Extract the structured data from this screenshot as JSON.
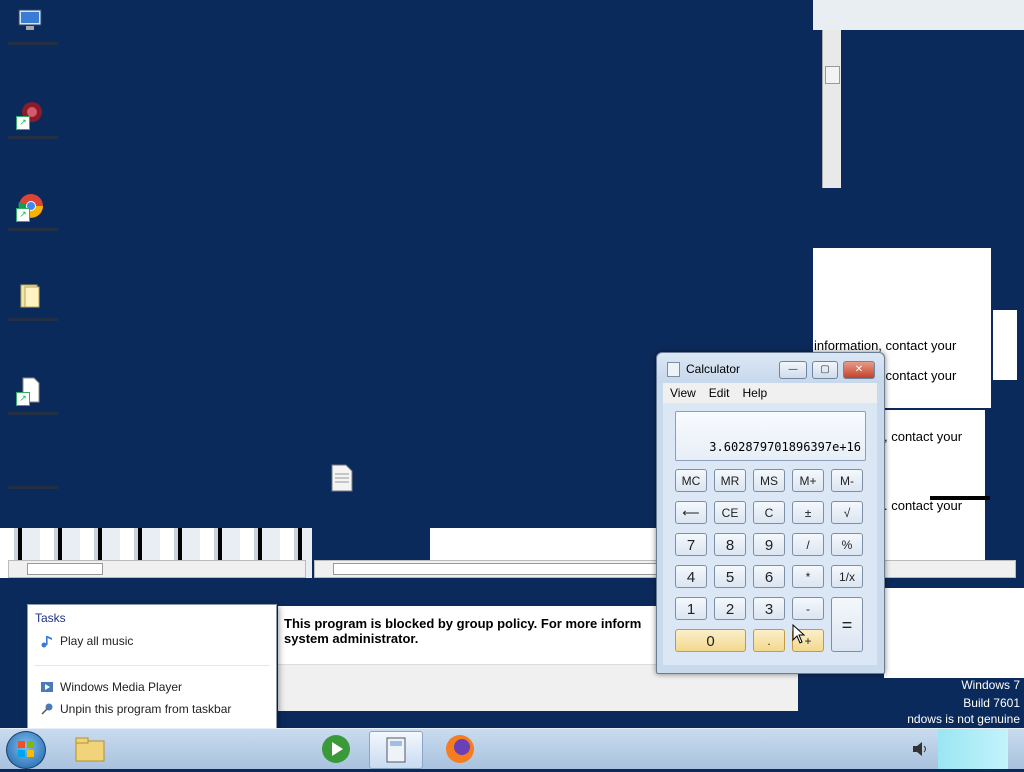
{
  "desktop": {
    "icons": [
      {
        "name": "computer-icon"
      },
      {
        "name": "network-tool-shortcut-icon"
      },
      {
        "name": "chrome-shortcut-icon"
      },
      {
        "name": "folder-icon"
      },
      {
        "name": "document-shortcut-icon"
      },
      {
        "name": "app-shortcut-icon"
      }
    ]
  },
  "background_text": {
    "line1": "information, contact your",
    "line2": ", contact your",
    "line3": ", contact your",
    "line4": ". contact your"
  },
  "message": {
    "line1": "This program is blocked by group policy. For more inform",
    "line2": "system administrator."
  },
  "jumplist": {
    "header": "Tasks",
    "task1": "Play all music",
    "pinned1": "Windows Media Player",
    "pinned2": "Unpin this program from taskbar"
  },
  "calculator": {
    "title": "Calculator",
    "menu": {
      "view": "View",
      "edit": "Edit",
      "help": "Help"
    },
    "display": "3.602879701896397e+16",
    "keys": {
      "mc": "MC",
      "mr": "MR",
      "ms": "MS",
      "mplus": "M+",
      "mminus": "M-",
      "back": "⟵",
      "ce": "CE",
      "c": "C",
      "plusminus": "±",
      "sqrt": "√",
      "k7": "7",
      "k8": "8",
      "k9": "9",
      "div": "/",
      "pct": "%",
      "k4": "4",
      "k5": "5",
      "k6": "6",
      "mul": "*",
      "inv": "1/x",
      "k1": "1",
      "k2": "2",
      "k3": "3",
      "sub": "-",
      "eq": "=",
      "k0": "0",
      "dot": ".",
      "add": "+"
    }
  },
  "watermark": {
    "line1": "Windows 7",
    "line2": "Build 7601",
    "line3": "ndows is not genuine"
  },
  "colors": {
    "desktop": "#0b2a5c",
    "highlight_key": "#f3d88e"
  }
}
